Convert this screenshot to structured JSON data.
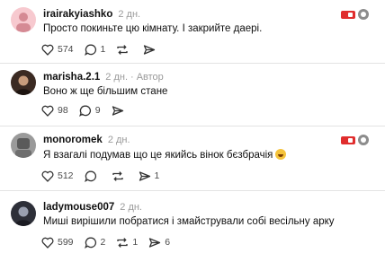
{
  "comments": [
    {
      "username": "irairakyiashko",
      "time": "2 дн.",
      "author_badge": "",
      "text": "Просто покиньте цю кімнату. І закрийте даері.",
      "likes": "574",
      "replies": "1",
      "reposts": "",
      "shares": "",
      "colors": {
        "avatar_bg": "#f7c9cf",
        "avatar_fg": "#d58a94"
      }
    },
    {
      "username": "marisha.2.1",
      "time": "2 дн.",
      "author_badge": "Автор",
      "text": "Воно ж ще більшим стане",
      "likes": "98",
      "replies": "9",
      "reposts": "",
      "shares": "",
      "colors": {
        "avatar_bg": "#3b2a22",
        "avatar_fg": "#c89c7c"
      }
    },
    {
      "username": "monoromek",
      "time": "2 дн.",
      "author_badge": "",
      "text": "Я взагалі подумав що це якийсь вінок бєзбрачія",
      "likes": "512",
      "replies": "",
      "reposts": "1",
      "shares": "",
      "colors": {
        "avatar_bg": "#9a9a9a",
        "avatar_fg": "#5a5a5a"
      }
    },
    {
      "username": "ladymouse007",
      "time": "2 дн.",
      "author_badge": "",
      "text": "Миші вирішили побратися і змайстрували собі весільну арку",
      "likes": "599",
      "replies": "2",
      "reposts": "1",
      "shares": "6",
      "colors": {
        "avatar_bg": "#2d2f38",
        "avatar_fg": "#9aa0b0"
      }
    }
  ],
  "icons": {
    "like": "heart-icon",
    "reply": "comment-icon",
    "repost": "repost-icon",
    "share": "share-icon",
    "flag": "flag-icon",
    "more": "more-icon"
  },
  "colors": {
    "accent_red": "#e02d2d",
    "meta_gray": "#9a9a9a",
    "separator": "#e3e3e3"
  }
}
